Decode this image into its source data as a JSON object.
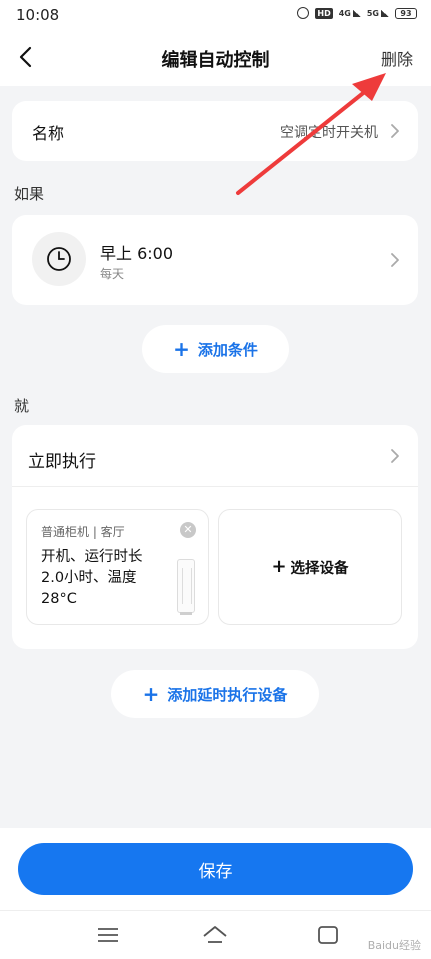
{
  "status_bar": {
    "time": "10:08",
    "hd": "HD",
    "net1": "4G",
    "net2": "5G",
    "battery": "93"
  },
  "header": {
    "title": "编辑自动控制",
    "delete_label": "删除"
  },
  "name_row": {
    "label": "名称",
    "value": "空调定时开关机"
  },
  "if_section": {
    "title": "如果",
    "condition": {
      "time": "早上 6:00",
      "repeat": "每天"
    },
    "add_condition_label": "添加条件"
  },
  "then_section": {
    "title": "就",
    "execute_label": "立即执行",
    "device": {
      "name": "普通柜机 | 客厅",
      "description": "开机、运行时长2.0小时、温度28°C"
    },
    "select_device_label": "选择设备",
    "add_delay_label": "添加延时执行设备"
  },
  "save_label": "保存",
  "watermark": "Baidu经验",
  "colors": {
    "accent": "#1a73e8",
    "save_button": "#1677f0",
    "annotation_arrow": "#ee3b3b",
    "background": "#f3f4f6"
  }
}
